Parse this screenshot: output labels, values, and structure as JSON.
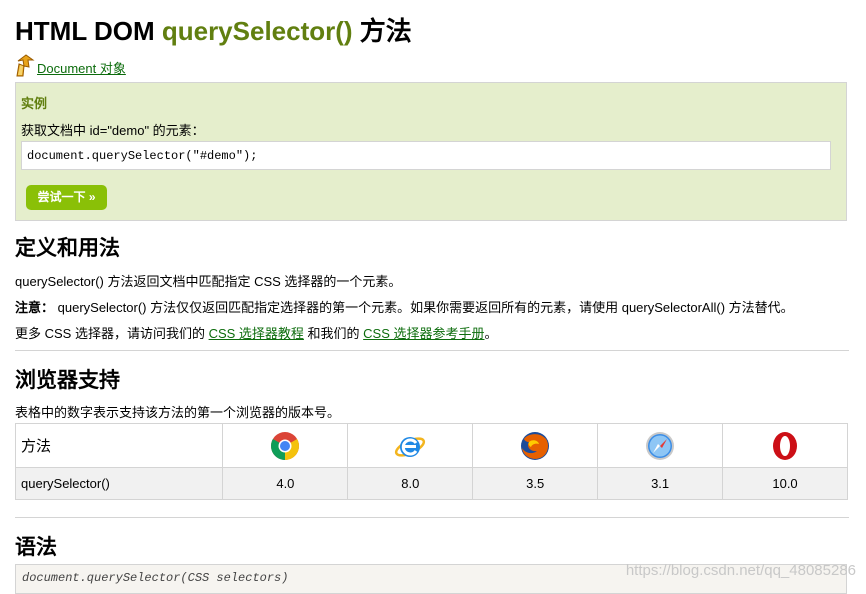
{
  "page": {
    "title_prefix": "HTML DOM ",
    "title_highlight": "querySelector()",
    "title_suffix": " 方法",
    "back_link": "Document 对象"
  },
  "example": {
    "heading": "实例",
    "description": "获取文档中 id=\"demo\" 的元素：",
    "code": "document.querySelector(\"#demo\");",
    "try_button": "尝试一下 »"
  },
  "definition": {
    "heading": "定义和用法",
    "line1": "querySelector() 方法返回文档中匹配指定 CSS 选择器的一个元素。",
    "note_label": "注意：",
    "note_text": " querySelector() 方法仅仅返回匹配指定选择器的第一个元素。如果你需要返回所有的元素，请使用 querySelectorAll() 方法替代。",
    "more_prefix": "更多 CSS 选择器，请访问我们的 ",
    "more_link1": "CSS 选择器教程",
    "more_mid": " 和我们的 ",
    "more_link2": "CSS 选择器参考手册",
    "more_suffix": "。"
  },
  "support": {
    "heading": "浏览器支持",
    "description": "表格中的数字表示支持该方法的第一个浏览器的版本号。",
    "method_header": "方法",
    "browsers": [
      "chrome-icon",
      "ie-icon",
      "firefox-icon",
      "safari-icon",
      "opera-icon"
    ],
    "method_name": "querySelector()",
    "versions": [
      "4.0",
      "8.0",
      "3.5",
      "3.1",
      "10.0"
    ]
  },
  "syntax": {
    "heading": "语法",
    "code": "document.querySelector(CSS selectors)"
  },
  "watermark": "https://blog.csdn.net/qq_48085286",
  "colors": {
    "accent_green": "#617f10",
    "link_green": "#0c6c0c",
    "example_bg": "#e5eecc",
    "button_green": "#8ac007"
  }
}
